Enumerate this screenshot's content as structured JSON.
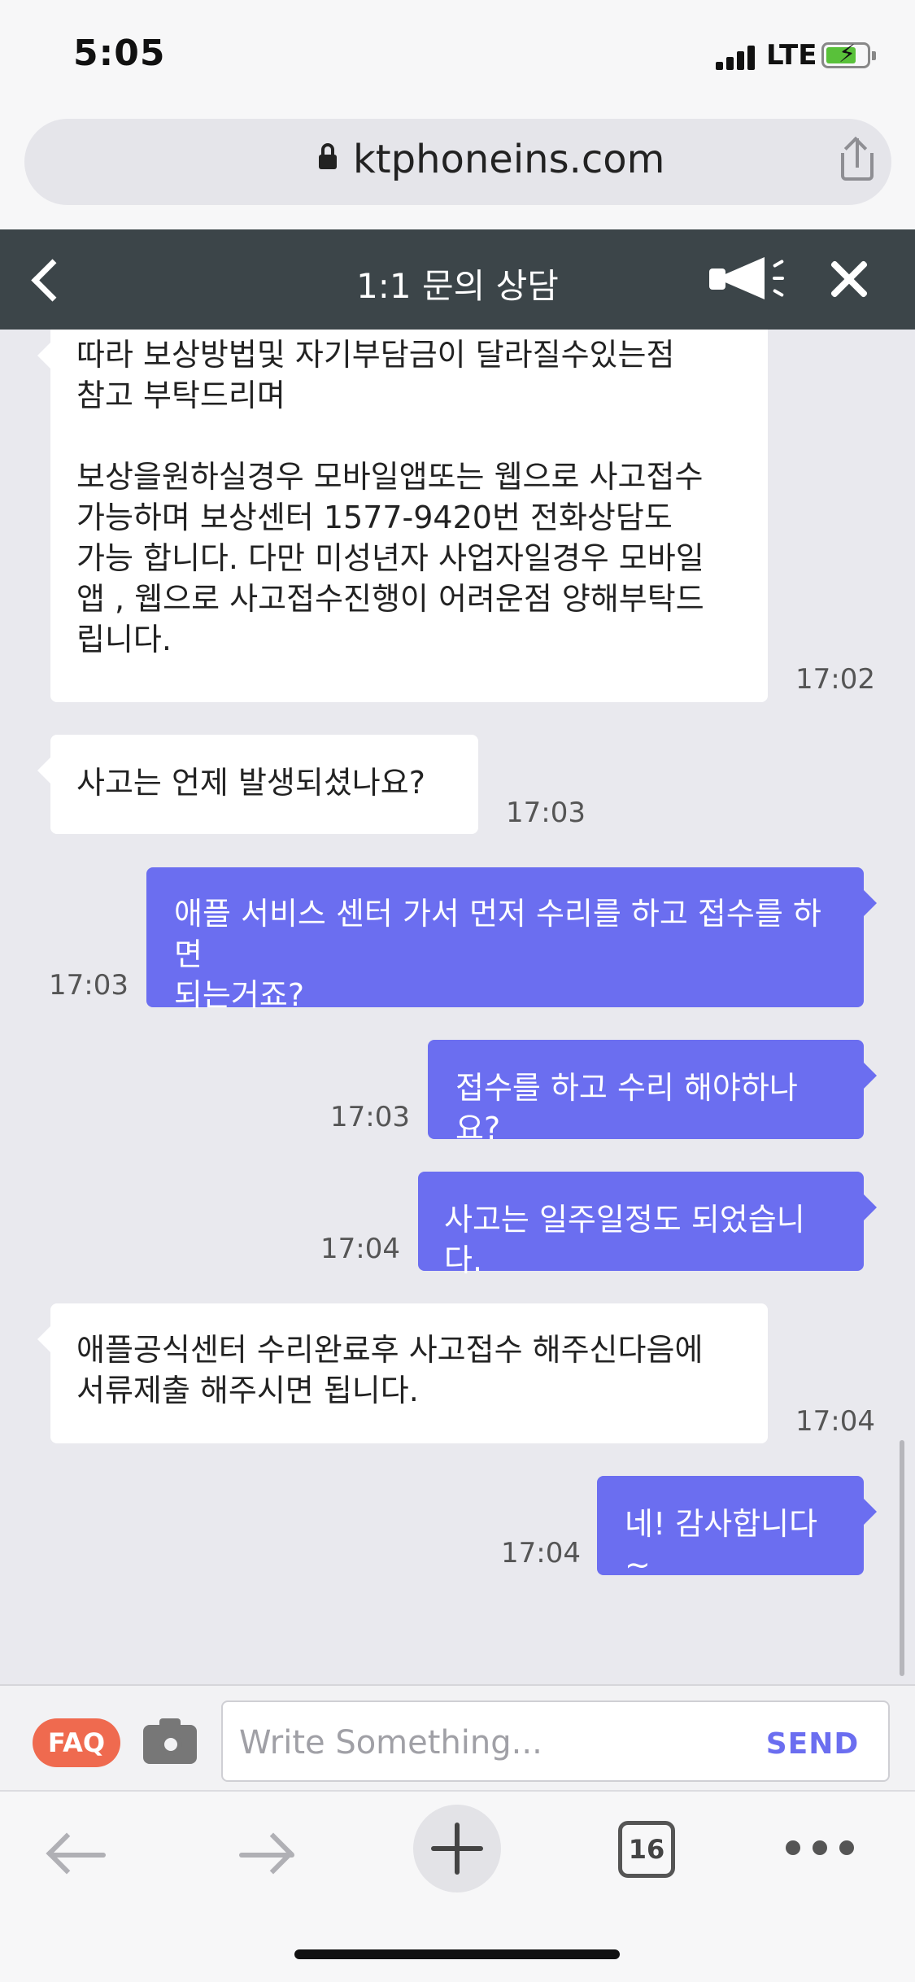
{
  "status": {
    "time": "5:05",
    "network": "LTE"
  },
  "browser": {
    "url": "ktphoneins.com",
    "tab_count": "16"
  },
  "header": {
    "title": "1:1 문의 상담"
  },
  "messages": [
    {
      "from": "agent",
      "text": "따라 보상방법및 자기부담금이 달라질수있는점\n참고 부탁드리며\n\n보상을원하실경우 모바일앱또는 웹으로 사고접수\n가능하며 보상센터 1577-9420번 전화상담도\n가능 합니다. 다만 미성년자 사업자일경우 모바일\n앱 , 웹으로 사고접수진행이 어려운점 양해부탁드\n립니다.",
      "time": "17:02"
    },
    {
      "from": "agent",
      "text": "사고는 언제 발생되셨나요?",
      "time": "17:03"
    },
    {
      "from": "user",
      "text": "애플 서비스 센터 가서 먼저 수리를 하고 접수를 하면\n되는거죠?",
      "time": "17:03"
    },
    {
      "from": "user",
      "text": "접수를 하고 수리 해야하나요?",
      "time": "17:03"
    },
    {
      "from": "user",
      "text": "사고는 일주일정도 되었습니다.",
      "time": "17:04"
    },
    {
      "from": "agent",
      "text": "애플공식센터 수리완료후 사고접수 해주신다음에\n서류제출 해주시면 됩니다.",
      "time": "17:04"
    },
    {
      "from": "user",
      "text": "네! 감사합니다~",
      "time": "17:04"
    }
  ],
  "input": {
    "faq_label": "FAQ",
    "placeholder": "Write Something...",
    "send_label": "SEND"
  },
  "colors": {
    "header_bg": "#3c4549",
    "user_bubble": "#6b6ef0",
    "faq_badge": "#ef6a4f",
    "chat_bg": "#e9e9ee"
  }
}
